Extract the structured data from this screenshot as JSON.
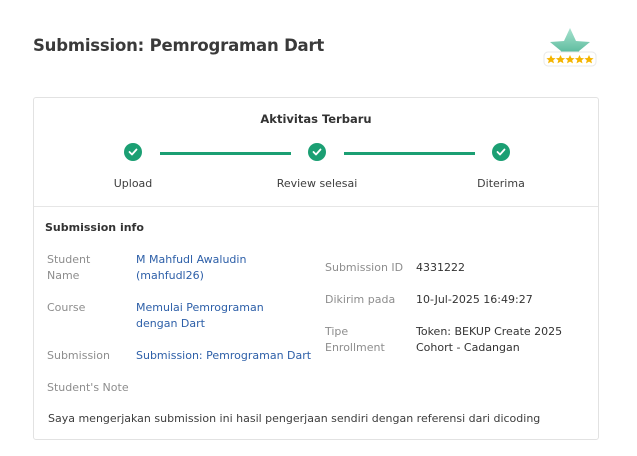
{
  "header": {
    "title": "Submission: Pemrograman Dart"
  },
  "badge": {
    "icon": "star-rating-badge-icon",
    "stars": 5,
    "colors": {
      "star": "#7fcfb5",
      "rating": "#f4b400"
    }
  },
  "activity": {
    "title": "Aktivitas Terbaru",
    "steps": [
      {
        "label": "Upload",
        "done": true
      },
      {
        "label": "Review selesai",
        "done": true
      },
      {
        "label": "Diterima",
        "done": true
      }
    ],
    "accent_color": "#1b9f73"
  },
  "submission_info": {
    "title": "Submission info",
    "student_name": {
      "label": "Student Name",
      "value": "M Mahfudl Awaludin (mahfudl26)"
    },
    "course": {
      "label": "Course",
      "value": "Memulai Pemrograman dengan Dart"
    },
    "submission": {
      "label": "Submission",
      "value": "Submission: Pemrograman Dart"
    },
    "submission_id": {
      "label": "Submission ID",
      "value": "4331222"
    },
    "sent_at": {
      "label": "Dikirim pada",
      "value": "10-Jul-2025 16:49:27"
    },
    "enrollment_type": {
      "label": "Tipe Enrollment",
      "value": "Token: BEKUP Create 2025 Cohort - Cadangan"
    },
    "student_note": {
      "label": "Student's Note",
      "value": "Saya mengerjakan submission ini hasil pengerjaan sendiri dengan referensi dari dicoding"
    }
  }
}
